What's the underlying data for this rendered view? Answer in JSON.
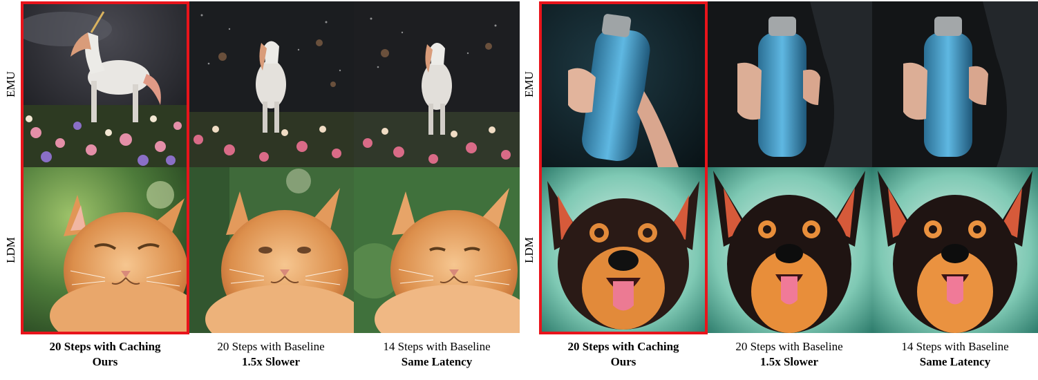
{
  "panels": [
    {
      "rows": [
        "EMU",
        "LDM"
      ],
      "columns": [
        {
          "line1": "20 Steps with Caching",
          "line2": "Ours",
          "highlighted": true
        },
        {
          "line1": "20 Steps with Baseline",
          "line2": "1.5x Slower",
          "highlighted": false
        },
        {
          "line1": "14 Steps with Baseline",
          "line2": "Same Latency",
          "highlighted": false
        }
      ],
      "images": {
        "top": [
          "unicorn-in-flower-field",
          "unicorn-in-flower-field",
          "unicorn-in-flower-field"
        ],
        "bottom": [
          "orange-tabby-cat",
          "orange-tabby-cat",
          "orange-tabby-cat"
        ]
      }
    },
    {
      "rows": [
        "EMU",
        "LDM"
      ],
      "columns": [
        {
          "line1": "20 Steps with Caching",
          "line2": "Ours",
          "highlighted": true
        },
        {
          "line1": "20 Steps with Baseline",
          "line2": "1.5x Slower",
          "highlighted": false
        },
        {
          "line1": "14 Steps with Baseline",
          "line2": "Same Latency",
          "highlighted": false
        }
      ],
      "images": {
        "top": [
          "hand-holding-blue-bottle",
          "hand-holding-blue-bottle",
          "hand-holding-blue-bottle"
        ],
        "bottom": [
          "dog-portrait-tongue-out",
          "dog-portrait-tongue-out",
          "dog-portrait-tongue-out"
        ]
      }
    }
  ],
  "colors": {
    "highlight": "#e8141b"
  }
}
